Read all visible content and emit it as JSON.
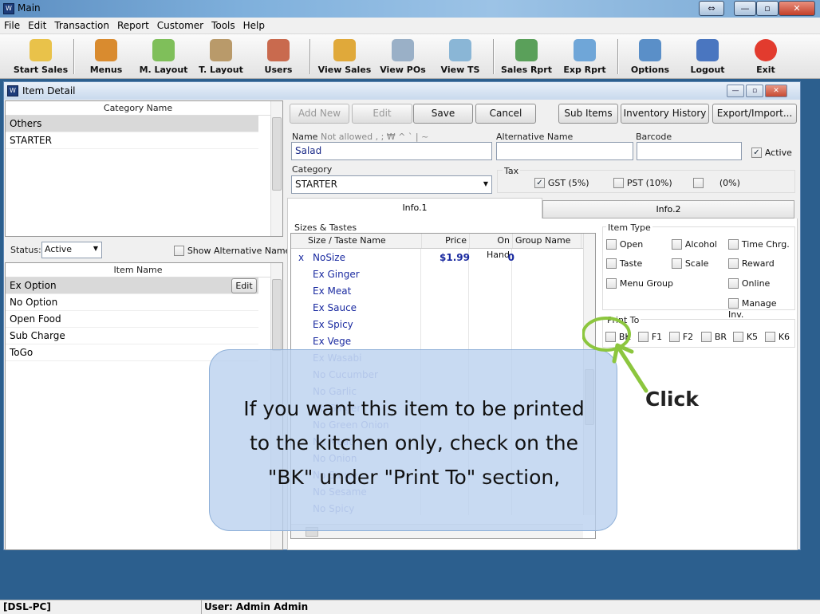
{
  "window": {
    "title": "Main",
    "controls": [
      "⇔",
      "—",
      "▫",
      "✕"
    ]
  },
  "menu": [
    "File",
    "Edit",
    "Transaction",
    "Report",
    "Customer",
    "Tools",
    "Help"
  ],
  "toolbar": [
    {
      "label": "Start Sales",
      "icon": "cash-register-icon",
      "color": "#e9c24a"
    },
    {
      "label": "Menus",
      "icon": "burger-icon",
      "color": "#d98b2f"
    },
    {
      "label": "M. Layout",
      "icon": "menu-layout-icon",
      "color": "#7fbf5a"
    },
    {
      "label": "T. Layout",
      "icon": "table-layout-icon",
      "color": "#b99a6a"
    },
    {
      "label": "Users",
      "icon": "users-icon",
      "color": "#c96a4e"
    },
    {
      "label": "View Sales",
      "icon": "view-sales-icon",
      "color": "#e0a93a"
    },
    {
      "label": "View POs",
      "icon": "purchase-orders-icon",
      "color": "#9ab0c7"
    },
    {
      "label": "View TS",
      "icon": "timesheet-icon",
      "color": "#8ab6d6"
    },
    {
      "label": "Sales Rprt",
      "icon": "sales-report-icon",
      "color": "#5aa05a"
    },
    {
      "label": "Exp Rprt",
      "icon": "expense-report-icon",
      "color": "#6fa6d8"
    },
    {
      "label": "Options",
      "icon": "options-icon",
      "color": "#5a8fc8"
    },
    {
      "label": "Logout",
      "icon": "logout-icon",
      "color": "#4a76c0"
    },
    {
      "label": "Exit",
      "icon": "power-icon",
      "color": "#e23b2e"
    }
  ],
  "item_detail": {
    "title": "Item Detail",
    "category_header": "Category Name",
    "categories": [
      {
        "name": "Others",
        "selected": true
      },
      {
        "name": "STARTER",
        "selected": false
      }
    ],
    "status_label": "Status:",
    "status_value": "Active",
    "show_alt_label": "Show Alternative Name",
    "item_header": "Item Name",
    "items": [
      {
        "name": "Ex Option",
        "selected": true
      },
      {
        "name": "No Option"
      },
      {
        "name": "Open Food"
      },
      {
        "name": "Sub Charge"
      },
      {
        "name": "ToGo"
      }
    ],
    "row_edit": "Edit",
    "buttons": {
      "add_new": "Add New",
      "edit": "Edit",
      "save": "Save",
      "cancel": "Cancel",
      "sub_items": "Sub Items",
      "inventory_history": "Inventory History",
      "export_import": "Export/Import..."
    },
    "name_label": "Name",
    "name_hint": "Not allowed , ; ₩ ^ ` | ~",
    "name_value": "Salad",
    "alt_name_label": "Alternative Name",
    "alt_name_value": "",
    "barcode_label": "Barcode",
    "barcode_value": "",
    "active_label": "Active",
    "category_label": "Category",
    "category_value": "STARTER",
    "tax_label": "Tax",
    "taxes": [
      {
        "label": "GST (5%)",
        "checked": true
      },
      {
        "label": "PST (10%)",
        "checked": false
      },
      {
        "label": "(0%)",
        "checked": false
      }
    ],
    "tabs": [
      "Info.1",
      "Info.2"
    ],
    "sizes_label": "Sizes & Tastes",
    "grid_headers": [
      "Size / Taste Name",
      "Price",
      "On Hand",
      "Group Name"
    ],
    "grid_rows": [
      {
        "mark": "x",
        "name": "NoSize",
        "price": "$1.99",
        "onhand": "0",
        "dim": false
      },
      {
        "mark": "",
        "name": "Ex Ginger",
        "price": "",
        "onhand": "",
        "dim": false
      },
      {
        "mark": "",
        "name": "Ex Meat",
        "price": "",
        "onhand": "",
        "dim": false
      },
      {
        "mark": "",
        "name": "Ex Sauce",
        "price": "",
        "onhand": "",
        "dim": false
      },
      {
        "mark": "",
        "name": "Ex Spicy",
        "price": "",
        "onhand": "",
        "dim": false
      },
      {
        "mark": "",
        "name": "Ex Vege",
        "price": "",
        "onhand": "",
        "dim": false
      },
      {
        "mark": "",
        "name": "Ex Wasabi",
        "price": "",
        "onhand": "",
        "dim": true
      },
      {
        "mark": "",
        "name": "No Cucumber",
        "price": "",
        "onhand": "",
        "dim": true
      },
      {
        "mark": "",
        "name": "No Garlic",
        "price": "",
        "onhand": "",
        "dim": true
      },
      {
        "mark": "",
        "name": "No Ginger",
        "price": "",
        "onhand": "",
        "dim": true
      },
      {
        "mark": "",
        "name": "No Green Onion",
        "price": "",
        "onhand": "",
        "dim": true
      },
      {
        "mark": "",
        "name": "No Meat",
        "price": "",
        "onhand": "",
        "dim": true
      },
      {
        "mark": "",
        "name": "No Onion",
        "price": "",
        "onhand": "",
        "dim": true
      },
      {
        "mark": "",
        "name": "No Sauce",
        "price": "",
        "onhand": "",
        "dim": true
      },
      {
        "mark": "",
        "name": "No Sesame",
        "price": "",
        "onhand": "",
        "dim": true
      },
      {
        "mark": "",
        "name": "No Spicy",
        "price": "",
        "onhand": "",
        "dim": true
      }
    ],
    "item_type_label": "Item Type",
    "item_types": [
      "Open",
      "Alcohol",
      "Time Chrg.",
      "Taste",
      "Scale",
      "Reward",
      "Menu Group",
      "Online",
      "Manage Inv."
    ],
    "print_to_label": "Print To",
    "print_to": [
      "BK",
      "F1",
      "F2",
      "BR",
      "K5",
      "K6"
    ]
  },
  "callout": {
    "text": "If you want this item to be printed to the kitchen only, check on the \"BK\" under \"Print To\" section,",
    "click_label": "Click"
  },
  "statusbar": {
    "pc": "[DSL-PC]",
    "user": "User: Admin Admin"
  }
}
